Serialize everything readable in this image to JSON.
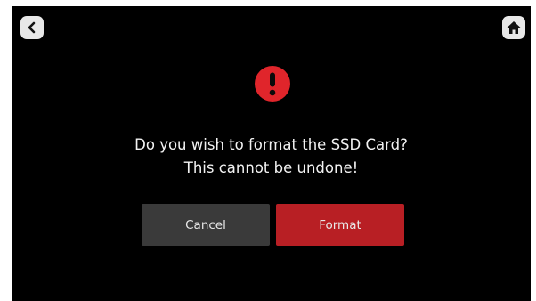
{
  "dialog": {
    "message_line1": "Do you wish to format the SSD Card?",
    "message_line2": "This cannot be undone!",
    "cancel_label": "Cancel",
    "format_label": "Format",
    "alert_icon": "exclamation-circle-icon"
  },
  "nav": {
    "back_icon": "chevron-left-icon",
    "home_icon": "home-icon"
  },
  "colors": {
    "background": "#000000",
    "alert": "#e0252b",
    "format_button": "#b81f24",
    "cancel_button": "#3a3a3a"
  }
}
